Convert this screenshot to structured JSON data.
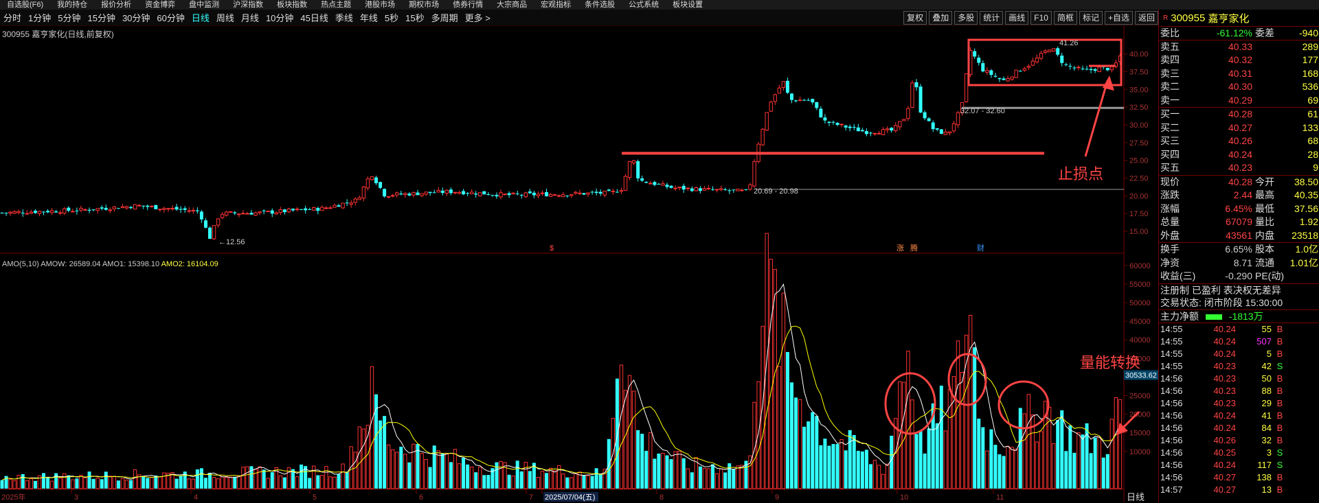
{
  "topmenu": [
    "自选股(F6)",
    "我的持仓",
    "报价分析",
    "资金博弈",
    "盘中监测",
    "沪深指数",
    "板块指数",
    "热点主题",
    "港股市场",
    "期权市场",
    "债券行情",
    "大宗商品",
    "宏观指标",
    "条件选股",
    "公式系统",
    "板块设置"
  ],
  "periods": [
    "分时",
    "1分钟",
    "5分钟",
    "15分钟",
    "30分钟",
    "60分钟",
    "日线",
    "周线",
    "月线",
    "10分钟",
    "45日线",
    "季线",
    "年线",
    "5秒",
    "15秒",
    "多周期",
    "更多 >"
  ],
  "active_period": "日线",
  "tools": [
    "复权",
    "叠加",
    "多股",
    "统计",
    "画线",
    "F10",
    "简框",
    "标记",
    "+自选",
    "返回"
  ],
  "chart_title": "300955 嘉亨家化(日线,前复权)",
  "indicator_title": {
    "name": "AMO(5,10)",
    "amow": "AMOW: 26589.04",
    "amo1": "AMO1: 15398.10",
    "amo2": "AMO2: 16104.09"
  },
  "price_axis": [
    "40.00",
    "37.50",
    "35.00",
    "32.50",
    "30.00",
    "27.50",
    "25.00",
    "22.50",
    "20.00",
    "17.50",
    "15.00"
  ],
  "vol_axis": [
    "60000",
    "55000",
    "50000",
    "45000",
    "40000",
    "35000",
    "30000",
    "25000",
    "20000",
    "15000",
    "10000"
  ],
  "vol_tag": "30533.62",
  "annotations": {
    "low": "←12.56",
    "high": "41.26",
    "zone1": "20.69 - 20.98",
    "zone2": "32.07 - 32.60",
    "stop_loss": "止损点",
    "volume_shift": "量能转换",
    "events": [
      "$",
      "涨",
      "腾",
      "财"
    ]
  },
  "date_axis": [
    "2025年",
    "3",
    "4",
    "5",
    "6",
    "7",
    "2025/07/04(五)",
    "8",
    "9",
    "10",
    "11"
  ],
  "bottom_tab": "日线",
  "quote": {
    "code": "300955",
    "name": "嘉亨家化",
    "r": "R",
    "wei": {
      "label1": "委比",
      "v1": "-61.12%",
      "label2": "委差",
      "v2": "-940"
    },
    "asks": [
      {
        "l": "卖五",
        "p": "40.33",
        "v": "289"
      },
      {
        "l": "卖四",
        "p": "40.32",
        "v": "177"
      },
      {
        "l": "卖三",
        "p": "40.31",
        "v": "168"
      },
      {
        "l": "卖二",
        "p": "40.30",
        "v": "536"
      },
      {
        "l": "卖一",
        "p": "40.29",
        "v": "69"
      }
    ],
    "bids": [
      {
        "l": "买一",
        "p": "40.28",
        "v": "61"
      },
      {
        "l": "买二",
        "p": "40.27",
        "v": "133"
      },
      {
        "l": "买三",
        "p": "40.26",
        "v": "68"
      },
      {
        "l": "买四",
        "p": "40.24",
        "v": "28"
      },
      {
        "l": "买五",
        "p": "40.23",
        "v": "9"
      }
    ],
    "stats": [
      {
        "a": "现价",
        "b": "40.28",
        "c": "今开",
        "d": "38.50"
      },
      {
        "a": "涨跌",
        "b": "2.44",
        "c": "最高",
        "d": "40.35"
      },
      {
        "a": "涨幅",
        "b": "6.45%",
        "c": "最低",
        "d": "37.56"
      },
      {
        "a": "总量",
        "b": "67079",
        "c": "量比",
        "d": "1.92"
      },
      {
        "a": "外盘",
        "b": "43561",
        "c": "内盘",
        "d": "23518"
      }
    ],
    "fund": [
      {
        "a": "换手",
        "b": "6.65%",
        "c": "股本",
        "d": "1.0亿"
      },
      {
        "a": "净资",
        "b": "8.71",
        "c": "流通",
        "d": "1.01亿"
      },
      {
        "a": "收益(三)",
        "b": "-0.290",
        "c": "PE(动)",
        "d": ""
      }
    ],
    "reg": "注册制 已盈利 表决权无差异",
    "status": "交易状态: 闭市阶段 15:30:00",
    "mainflow": {
      "label": "主力净额",
      "value": "-1813万"
    },
    "ticks": [
      {
        "t": "14:55",
        "p": "40.24",
        "v": "55",
        "s": "B"
      },
      {
        "t": "14:55",
        "p": "40.24",
        "v": "507",
        "s": "B"
      },
      {
        "t": "14:55",
        "p": "40.24",
        "v": "5",
        "s": "B"
      },
      {
        "t": "14:55",
        "p": "40.23",
        "v": "42",
        "s": "S"
      },
      {
        "t": "14:56",
        "p": "40.23",
        "v": "50",
        "s": "B"
      },
      {
        "t": "14:56",
        "p": "40.23",
        "v": "88",
        "s": "B"
      },
      {
        "t": "14:56",
        "p": "40.23",
        "v": "29",
        "s": "B"
      },
      {
        "t": "14:56",
        "p": "40.24",
        "v": "41",
        "s": "B"
      },
      {
        "t": "14:56",
        "p": "40.24",
        "v": "84",
        "s": "B"
      },
      {
        "t": "14:56",
        "p": "40.26",
        "v": "32",
        "s": "B"
      },
      {
        "t": "14:56",
        "p": "40.25",
        "v": "3",
        "s": "S"
      },
      {
        "t": "14:56",
        "p": "40.24",
        "v": "117",
        "s": "S"
      },
      {
        "t": "14:56",
        "p": "40.27",
        "v": "138",
        "s": "B"
      },
      {
        "t": "14:57",
        "p": "40.27",
        "v": "13",
        "s": "B"
      }
    ]
  },
  "colors": {
    "up": "#ff3333",
    "down": "#33ffff",
    "ma1": "#ffffff",
    "ma2": "#ffff00",
    "annot": "#ff4444"
  }
}
